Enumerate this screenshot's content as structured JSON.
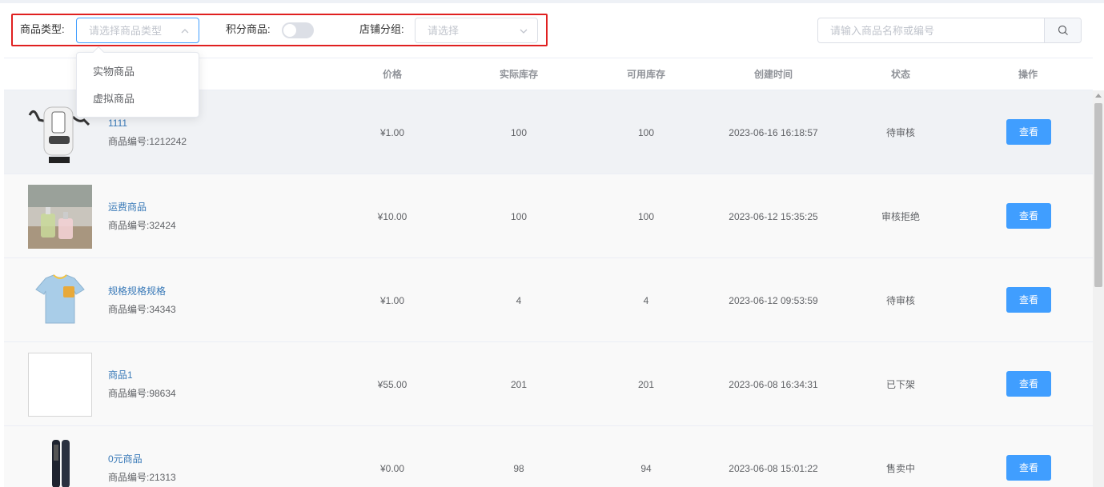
{
  "filters": {
    "type_label": "商品类型:",
    "type_placeholder": "请选择商品类型",
    "points_label": "积分商品:",
    "points_enabled": false,
    "group_label": "店铺分组:",
    "group_placeholder": "请选择"
  },
  "search": {
    "placeholder": "请输入商品名称或编号"
  },
  "dropdown": {
    "options": [
      "实物商品",
      "虚拟商品"
    ]
  },
  "table": {
    "headers": [
      "价格",
      "实际库存",
      "可用库存",
      "创建时间",
      "状态",
      "操作"
    ],
    "rows": [
      {
        "name": "1111",
        "code": "商品编号:1212242",
        "price": "¥1.00",
        "actual_stock": "100",
        "available_stock": "100",
        "created": "2023-06-16 16:18:57",
        "status": "待审核",
        "action": "查看",
        "image": "robot-vacuum-image"
      },
      {
        "name": "运费商品",
        "code": "商品编号:32424",
        "price": "¥10.00",
        "actual_stock": "100",
        "available_stock": "100",
        "created": "2023-06-12 15:35:25",
        "status": "审核拒绝",
        "action": "查看",
        "image": "perfume-bottles-image"
      },
      {
        "name": "规格规格规格",
        "code": "商品编号:34343",
        "price": "¥1.00",
        "actual_stock": "4",
        "available_stock": "4",
        "created": "2023-06-12 09:53:59",
        "status": "待审核",
        "action": "查看",
        "image": "kids-tshirt-image"
      },
      {
        "name": "商品1",
        "code": "商品编号:98634",
        "price": "¥55.00",
        "actual_stock": "201",
        "available_stock": "201",
        "created": "2023-06-08 16:34:31",
        "status": "已下架",
        "action": "查看",
        "image": "empty-image"
      },
      {
        "name": "0元商品",
        "code": "商品编号:21313",
        "price": "¥0.00",
        "actual_stock": "98",
        "available_stock": "94",
        "created": "2023-06-08 15:01:22",
        "status": "售卖中",
        "action": "查看",
        "image": "hair-straightener-image"
      }
    ]
  },
  "colors": {
    "primary": "#409eff",
    "highlight_border": "#e02020",
    "link": "#3a7ab8"
  }
}
